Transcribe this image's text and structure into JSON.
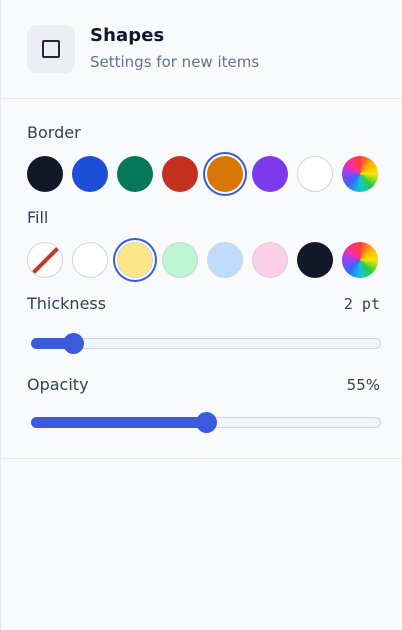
{
  "header": {
    "title": "Shapes",
    "subtitle": "Settings for new items",
    "icon": "square-icon"
  },
  "border": {
    "label": "Border",
    "swatches": [
      {
        "name": "navy",
        "color": "#111827"
      },
      {
        "name": "blue",
        "color": "#1d4ed8"
      },
      {
        "name": "green",
        "color": "#047857"
      },
      {
        "name": "red",
        "color": "#c53021"
      },
      {
        "name": "orange",
        "color": "#d97706",
        "selected": true
      },
      {
        "name": "purple",
        "color": "#7c3aed"
      },
      {
        "name": "white",
        "color": "#ffffff"
      },
      {
        "name": "custom",
        "color": "rainbow"
      }
    ]
  },
  "fill": {
    "label": "Fill",
    "swatches": [
      {
        "name": "none",
        "color": "none"
      },
      {
        "name": "white",
        "color": "#ffffff"
      },
      {
        "name": "yellow",
        "color": "#fde68a",
        "selected": true
      },
      {
        "name": "mint",
        "color": "#bbf7d0"
      },
      {
        "name": "light-blue",
        "color": "#bfdbfe"
      },
      {
        "name": "pink",
        "color": "#fbcfe8"
      },
      {
        "name": "navy",
        "color": "#111827"
      },
      {
        "name": "custom",
        "color": "rainbow"
      }
    ]
  },
  "thickness": {
    "label": "Thickness",
    "value_text": "2 pt",
    "fraction": 0.12
  },
  "opacity": {
    "label": "Opacity",
    "value_text": "55%",
    "fraction": 0.5
  }
}
